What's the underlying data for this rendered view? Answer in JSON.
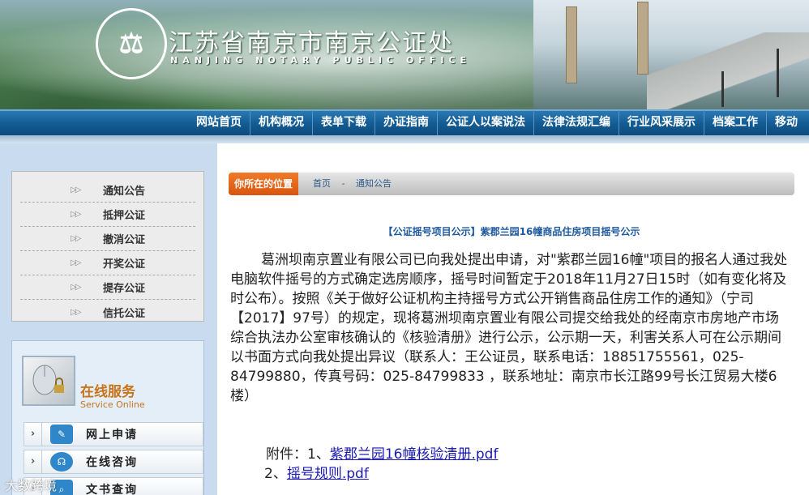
{
  "header": {
    "title": "江苏省南京市南京公证处",
    "subtitle": "NANJING NOTARY PUBLIC OFFICE",
    "seal_text": "南京公证处",
    "seal_sub": "NANJING NOTARY PUBLIC OFFICE"
  },
  "nav": {
    "items": [
      "网站首页",
      "机构概况",
      "表单下载",
      "办证指南",
      "公证人以案说法",
      "法律法规汇编",
      "行业风采展示",
      "档案工作",
      "移动"
    ]
  },
  "sidebar": {
    "menu": [
      "通知公告",
      "抵押公证",
      "撤消公证",
      "开奖公证",
      "提存公证",
      "信托公证"
    ],
    "service": {
      "title": "在线服务",
      "subtitle": "Service Online",
      "rows": [
        "网上申请",
        "在线咨询",
        "文书查询"
      ]
    },
    "watermark": "大数跨境"
  },
  "breadcrumb": {
    "tag": "你所在的位置",
    "home": "首页",
    "separator": "-",
    "current": "通知公告"
  },
  "article": {
    "title": "【公证摇号项目公示】紫郡兰园16幢商品住房项目摇号公示",
    "body": "葛洲坝南京置业有限公司已向我处提出申请，对\"紫郡兰园16幢\"项目的报名人通过我处电脑软件摇号的方式确定选房顺序，摇号时间暂定于2018年11月27日15时（如有变化将及时公布）。按照《关于做好公证机构主持摇号方式公开销售商品住房工作的通知》（宁司【2017】97号）的规定，现将葛洲坝南京置业有限公司提交给我处的经南京市房地产市场综合执法办公室审核确认的《核验清册》进行公示，公示期一天，利害关系人可在公示期间以书面方式向我处提出异议（联系人：王公证员，联系电话：18851755561，025-84799880，传真号码：025-84799833 ，联系地址：南京市长江路99号长江贸易大楼6楼）",
    "attachments_label": "附件：1、",
    "attachment1": "紫郡兰园16幢核验清册.pdf",
    "attachment2_prefix": "2、",
    "attachment2": "摇号规则.pdf"
  },
  "colors": {
    "nav_bg": "#135d95",
    "crumb_tag": "#e8671c",
    "title_blue": "#1f5a9e",
    "service_orange": "#c8741a",
    "link": "#1a1ab3"
  }
}
